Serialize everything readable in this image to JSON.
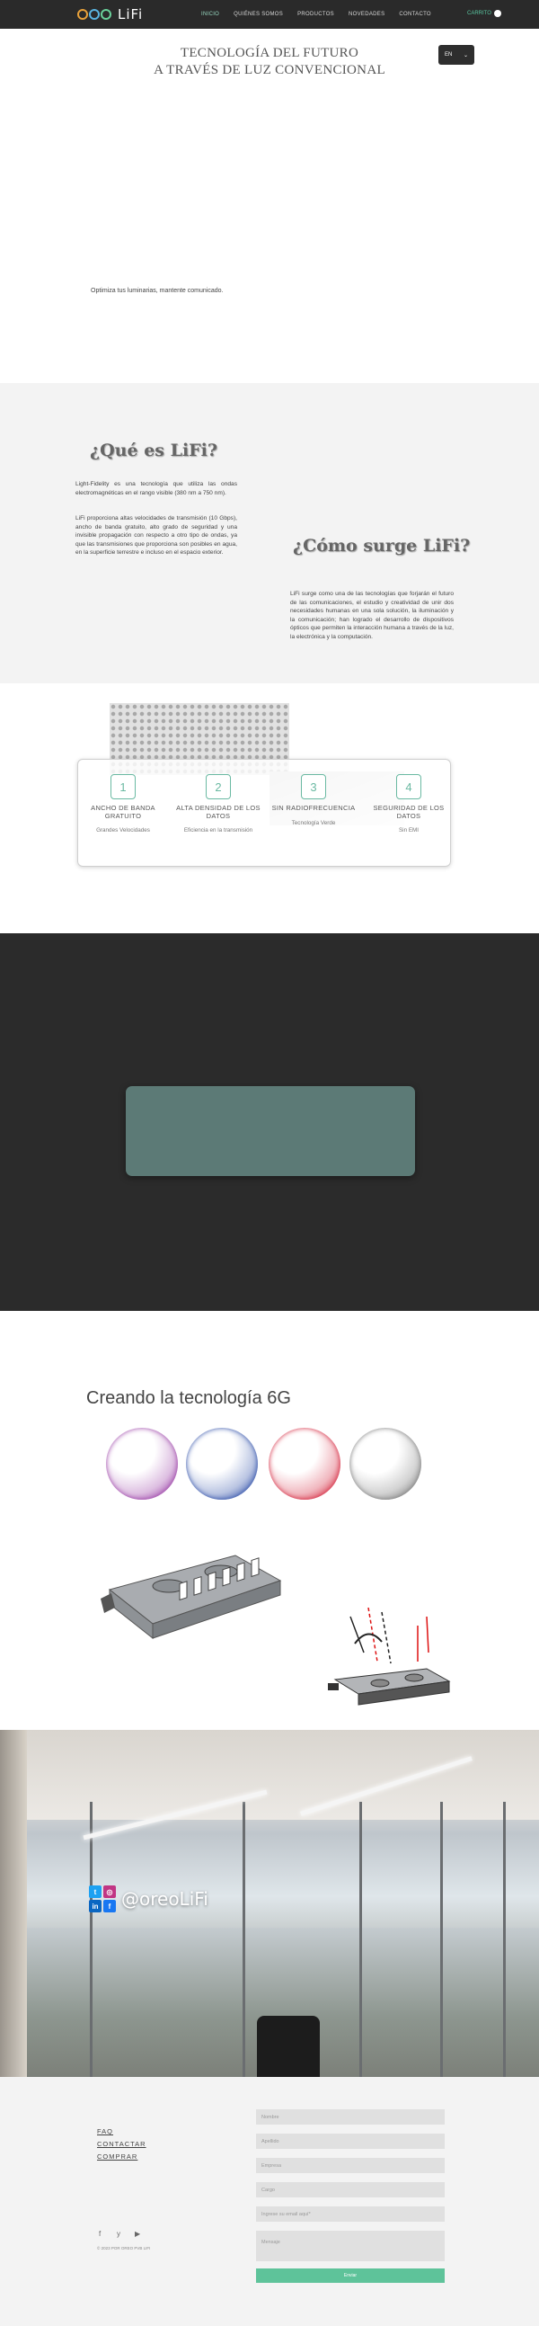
{
  "colors": {
    "header_bg": "#2a2a2a",
    "accent_teal": "#6ab9a2",
    "cart_green": "#59c6a0",
    "send_green": "#5ec39a",
    "dark_section": "#2b2b2b",
    "teal_box": "#5c7a76"
  },
  "header": {
    "logo_text": "LiFi",
    "logo_word": "oreo",
    "nav": [
      "INICIO",
      "QUIÉNES SOMOS",
      "PRODUCTOS",
      "NOVEDADES",
      "CONTACTO"
    ],
    "cart_label": "CARRITO",
    "cart_icon": "cart-badge-icon"
  },
  "hero": {
    "title_line1": "TECNOLOGÍA DEL FUTURO",
    "title_line2": "A TRAVÉS DE  LUZ CONVENCIONAL",
    "lang_selected": "EN",
    "subtitle": "Optimiza tus luminarias, mantente comunicado."
  },
  "what": {
    "heading1": "¿Qué es LiFi?",
    "para1": "Light-Fidelity es una tecnología que utiliza las ondas electromagnéticas en el rango visible (380 nm a 750 nm).",
    "para2": "LiFi proporciona altas velocidades de transmisión (10 Gbps), ancho de banda gratuito, alto grado de seguridad y una invisible propagación con respecto a otro tipo de ondas, ya que las transmisiones que proporciona son posibles en agua, en la superficie terrestre e incluso en el espacio exterior.",
    "heading2": "¿Cómo surge LiFi?",
    "para3": "LiFi surge como una de las tecnologías que forjarán el futuro de las comunicaciones, el estudio y creatividad de unir dos necesidades humanas en una sola solución, la iluminación y la comunicación; han logrado el desarrollo de dispositivos ópticos que permiten la interacción humana a través de la luz, la electrónica y la computación."
  },
  "features": [
    {
      "num": "1",
      "title": "ANCHO DE BANDA GRATUITO",
      "desc": "Grandes Velocidades"
    },
    {
      "num": "2",
      "title": "ALTA DENSIDAD DE LOS DATOS",
      "desc": "Eficiencia en la transmisión"
    },
    {
      "num": "3",
      "title": "SIN RADIOFRECUENCIA",
      "desc": "Tecnología Verde"
    },
    {
      "num": "4",
      "title": "SEGURIDAD DE LOS DATOS",
      "desc": "Sin EMI"
    }
  ],
  "sixg": {
    "title": "Creando la tecnología 6G",
    "spheres": [
      "#9a3fa6",
      "#2f4fa8",
      "#d4283f",
      "#7a7a7a"
    ]
  },
  "office": {
    "handle": "@oreoLiFi",
    "icons": [
      "twitter-icon",
      "instagram-icon",
      "linkedin-icon",
      "facebook-icon"
    ]
  },
  "footer": {
    "links": [
      "FAQ",
      "CONTACTAR",
      "COMPRAR"
    ],
    "social_icons": [
      "f",
      "y",
      "▶"
    ],
    "copyright": "© 2023 POR OREO PVB LIFI",
    "form": {
      "nombre": "Nombre",
      "apellido": "Apellido",
      "empresa": "Empresa",
      "cargo": "Cargo",
      "email": "Ingrese su email aquí*",
      "mensaje": "Mensaje",
      "send": "Enviar"
    }
  }
}
